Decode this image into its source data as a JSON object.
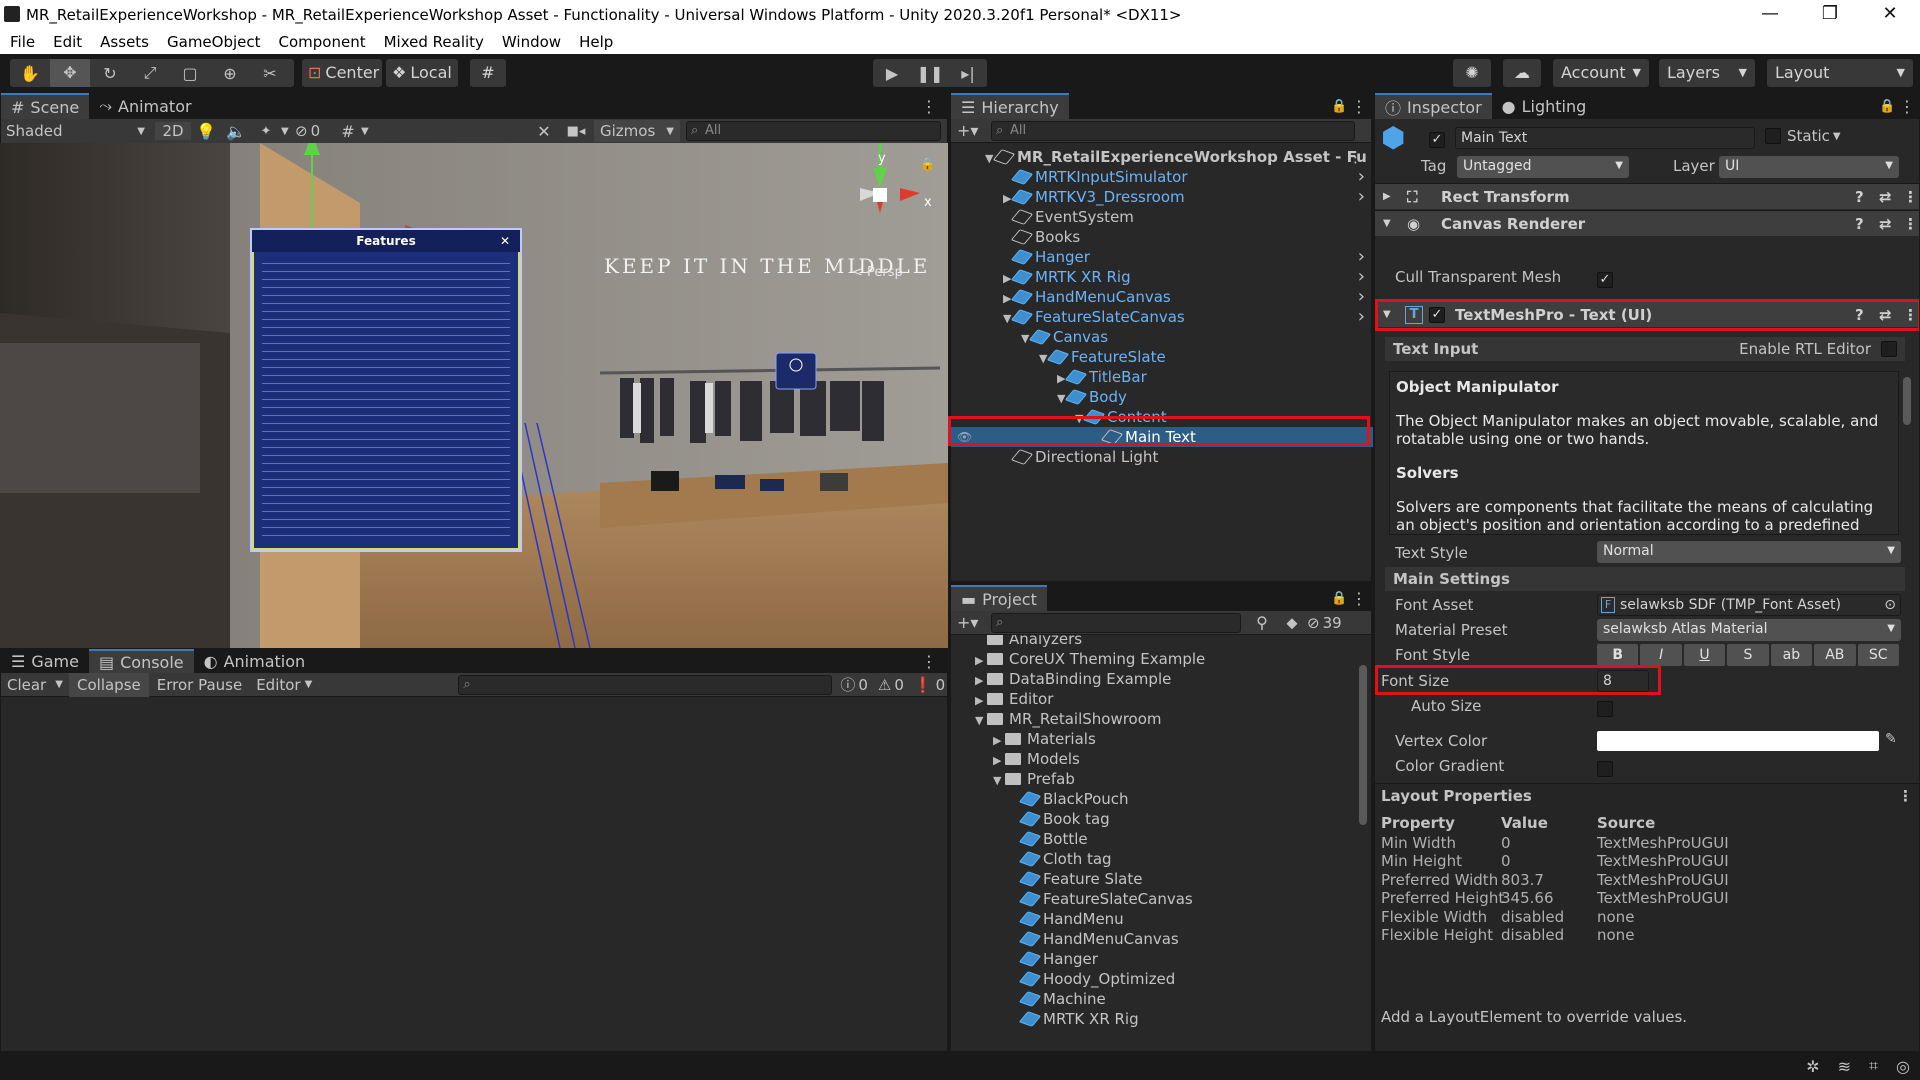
{
  "window": {
    "title": "MR_RetailExperienceWorkshop - MR_RetailExperienceWorkshop Asset - Functionality - Universal Windows Platform - Unity 2020.3.20f1 Personal* <DX11>",
    "minimize": "—",
    "restore": "❐",
    "close": "✕"
  },
  "menu": [
    "File",
    "Edit",
    "Assets",
    "GameObject",
    "Component",
    "Mixed Reality",
    "Window",
    "Help"
  ],
  "toolbar": {
    "center_label": "Center",
    "local_label": "Local",
    "account_label": "Account",
    "layers_label": "Layers",
    "layout_label": "Layout"
  },
  "scene": {
    "tabs": [
      "Scene",
      "Animator"
    ],
    "shading": "Shaded",
    "mode_2d": "2D",
    "hidden_count": "0",
    "gizmos": "Gizmos",
    "search_placeholder": "All",
    "persp_label": "< Persp",
    "wall_text": "KEEP IT IN THE MIDDLE",
    "panel_title": "Features",
    "axis_x": "x",
    "axis_y": "y"
  },
  "console": {
    "tabs": [
      "Game",
      "Console",
      "Animation"
    ],
    "clear": "Clear",
    "collapse": "Collapse",
    "error_pause": "Error Pause",
    "editor": "Editor",
    "count_log": "0",
    "count_warn": "0",
    "count_err": "0"
  },
  "hierarchy": {
    "tab": "Hierarchy",
    "search_placeholder": "All",
    "items": [
      {
        "label": "MR_RetailExperienceWorkshop Asset - Fu",
        "indent": 0,
        "arrow": "▼",
        "blue": false,
        "bold": true
      },
      {
        "label": "MRTKInputSimulator",
        "indent": 1,
        "arrow": "",
        "blue": true
      },
      {
        "label": "MRTKV3_Dressroom",
        "indent": 1,
        "arrow": "▶",
        "blue": true
      },
      {
        "label": "EventSystem",
        "indent": 1,
        "arrow": "",
        "blue": false
      },
      {
        "label": "Books",
        "indent": 1,
        "arrow": "",
        "blue": false
      },
      {
        "label": "Hanger",
        "indent": 1,
        "arrow": "",
        "blue": true
      },
      {
        "label": "MRTK XR Rig",
        "indent": 1,
        "arrow": "▶",
        "blue": true
      },
      {
        "label": "HandMenuCanvas",
        "indent": 1,
        "arrow": "▶",
        "blue": true
      },
      {
        "label": "FeatureSlateCanvas",
        "indent": 1,
        "arrow": "▼",
        "blue": true
      },
      {
        "label": "Canvas",
        "indent": 2,
        "arrow": "▼",
        "blue": true
      },
      {
        "label": "FeatureSlate",
        "indent": 3,
        "arrow": "▼",
        "blue": true
      },
      {
        "label": "TitleBar",
        "indent": 4,
        "arrow": "▶",
        "blue": true
      },
      {
        "label": "Body",
        "indent": 4,
        "arrow": "▼",
        "blue": true
      },
      {
        "label": "Content",
        "indent": 5,
        "arrow": "▼",
        "blue": true
      },
      {
        "label": "Main Text",
        "indent": 6,
        "arrow": "",
        "blue": false,
        "selected": true
      },
      {
        "label": "Directional Light",
        "indent": 1,
        "arrow": "",
        "blue": false
      }
    ]
  },
  "project": {
    "tab": "Project",
    "hidden_count": "39",
    "items": [
      {
        "label": "Analyzers",
        "indent": 1,
        "type": "folder",
        "arrow": ""
      },
      {
        "label": "CoreUX Theming Example",
        "indent": 1,
        "type": "folder",
        "arrow": "▶"
      },
      {
        "label": "DataBinding Example",
        "indent": 1,
        "type": "folder",
        "arrow": "▶"
      },
      {
        "label": "Editor",
        "indent": 1,
        "type": "folder",
        "arrow": "▶"
      },
      {
        "label": "MR_RetailShowroom",
        "indent": 1,
        "type": "folder",
        "arrow": "▼"
      },
      {
        "label": "Materials",
        "indent": 2,
        "type": "folder",
        "arrow": "▶"
      },
      {
        "label": "Models",
        "indent": 2,
        "type": "folder",
        "arrow": "▶"
      },
      {
        "label": "Prefab",
        "indent": 2,
        "type": "folder",
        "arrow": "▼"
      },
      {
        "label": "BlackPouch",
        "indent": 3,
        "type": "prefab",
        "arrow": ""
      },
      {
        "label": "Book tag",
        "indent": 3,
        "type": "prefab",
        "arrow": ""
      },
      {
        "label": "Bottle",
        "indent": 3,
        "type": "prefab",
        "arrow": ""
      },
      {
        "label": "Cloth tag",
        "indent": 3,
        "type": "prefab",
        "arrow": ""
      },
      {
        "label": "Feature Slate",
        "indent": 3,
        "type": "prefab",
        "arrow": ""
      },
      {
        "label": "FeatureSlateCanvas",
        "indent": 3,
        "type": "prefab",
        "arrow": ""
      },
      {
        "label": "HandMenu",
        "indent": 3,
        "type": "prefab",
        "arrow": ""
      },
      {
        "label": "HandMenuCanvas",
        "indent": 3,
        "type": "prefab",
        "arrow": ""
      },
      {
        "label": "Hanger",
        "indent": 3,
        "type": "prefab",
        "arrow": ""
      },
      {
        "label": "Hoody_Optimized",
        "indent": 3,
        "type": "prefab",
        "arrow": ""
      },
      {
        "label": "Machine",
        "indent": 3,
        "type": "prefab",
        "arrow": ""
      },
      {
        "label": "MRTK XR Rig",
        "indent": 3,
        "type": "prefab",
        "arrow": ""
      }
    ]
  },
  "inspector": {
    "tabs": [
      "Inspector",
      "Lighting"
    ],
    "object_name": "Main Text",
    "static_label": "Static",
    "tag_label": "Tag",
    "tag_value": "Untagged",
    "layer_label": "Layer",
    "layer_value": "UI",
    "components": {
      "rect_transform": "Rect Transform",
      "canvas_renderer": "Canvas Renderer",
      "cull_label": "Cull Transparent Mesh",
      "tmp": "TextMeshPro - Text (UI)"
    },
    "text_input_label": "Text Input",
    "rtl_label": "Enable RTL Editor",
    "text_content": {
      "h1": "Object Manipulator",
      "p1": "The Object Manipulator makes an object movable, scalable, and rotatable using one or two hands.",
      "h2": "Solvers",
      "p2": "Solvers are components that facilitate the means of calculating an object's position and orientation according to a predefined"
    },
    "text_style_label": "Text Style",
    "text_style_value": "Normal",
    "main_settings": "Main Settings",
    "font_asset_label": "Font Asset",
    "font_asset_value": "selawksb SDF (TMP_Font Asset)",
    "material_preset_label": "Material Preset",
    "material_preset_value": "selawksb Atlas Material",
    "font_style_label": "Font Style",
    "font_style_buttons": [
      "B",
      "I",
      "U",
      "S",
      "ab",
      "AB",
      "SC"
    ],
    "font_size_label": "Font Size",
    "font_size_value": "8",
    "auto_size_label": "Auto Size",
    "vertex_color_label": "Vertex Color",
    "color_gradient_label": "Color Gradient",
    "layout_properties": {
      "title": "Layout Properties",
      "headers": [
        "Property",
        "Value",
        "Source"
      ],
      "rows": [
        [
          "Min Width",
          "0",
          "TextMeshProUGUI"
        ],
        [
          "Min Height",
          "0",
          "TextMeshProUGUI"
        ],
        [
          "Preferred Width",
          "803.7",
          "TextMeshProUGUI"
        ],
        [
          "Preferred Height",
          "345.66",
          "TextMeshProUGUI"
        ],
        [
          "Flexible Width",
          "disabled",
          "none"
        ],
        [
          "Flexible Height",
          "disabled",
          "none"
        ]
      ],
      "note": "Add a LayoutElement to override values."
    }
  },
  "colors": {
    "accent": "#2c5d87",
    "highlight": "#e0111a",
    "prefab_blue": "#6cb3f5"
  }
}
